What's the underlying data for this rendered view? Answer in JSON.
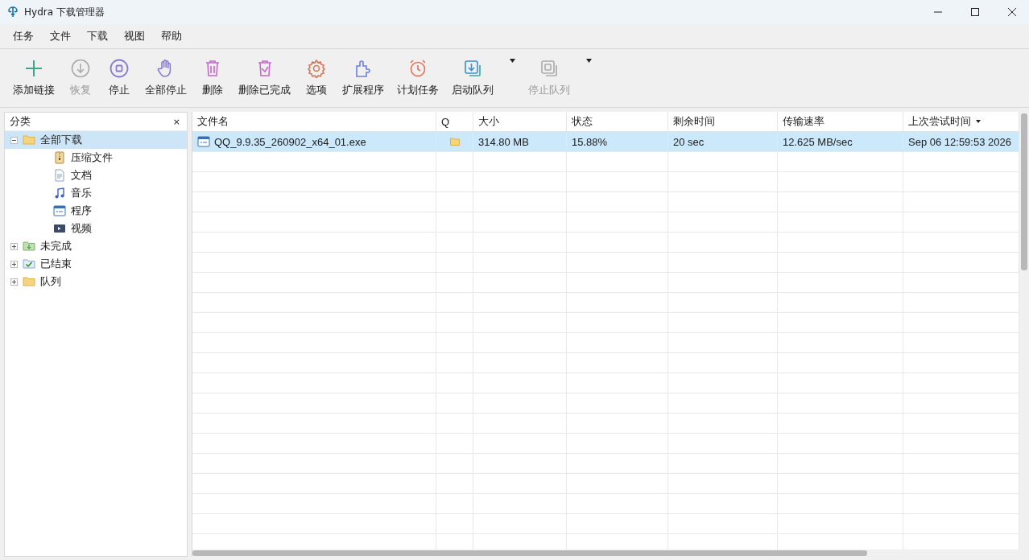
{
  "window": {
    "title": "Hydra 下载管理器"
  },
  "menu": [
    "任务",
    "文件",
    "下载",
    "视图",
    "帮助"
  ],
  "toolbar": [
    {
      "label": "添加链接",
      "disabled": false,
      "dropdown": false
    },
    {
      "label": "恢复",
      "disabled": true,
      "dropdown": false
    },
    {
      "label": "停止",
      "disabled": false,
      "dropdown": false
    },
    {
      "label": "全部停止",
      "disabled": false,
      "dropdown": false
    },
    {
      "label": "删除",
      "disabled": false,
      "dropdown": false
    },
    {
      "label": "删除已完成",
      "disabled": false,
      "dropdown": false
    },
    {
      "label": "选项",
      "disabled": false,
      "dropdown": false
    },
    {
      "label": "扩展程序",
      "disabled": false,
      "dropdown": false
    },
    {
      "label": "计划任务",
      "disabled": false,
      "dropdown": false
    },
    {
      "label": "启动队列",
      "disabled": false,
      "dropdown": true
    },
    {
      "label": "停止队列",
      "disabled": true,
      "dropdown": true
    }
  ],
  "sidebar": {
    "title": "分类",
    "close": "×",
    "items": [
      {
        "label": "全部下载",
        "selected": true,
        "expanded": true,
        "children": [
          {
            "label": "压缩文件",
            "selected": false
          },
          {
            "label": "文档",
            "selected": false
          },
          {
            "label": "音乐",
            "selected": false
          },
          {
            "label": "程序",
            "selected": false
          },
          {
            "label": "视频",
            "selected": false
          }
        ]
      },
      {
        "label": "未完成",
        "selected": false,
        "expanded": false
      },
      {
        "label": "已结束",
        "selected": false,
        "expanded": false
      },
      {
        "label": "队列",
        "selected": false,
        "expanded": false
      }
    ]
  },
  "table": {
    "columns": [
      {
        "label": "文件名",
        "sorted": false
      },
      {
        "label": "Q",
        "sorted": false
      },
      {
        "label": "大小",
        "sorted": false
      },
      {
        "label": "状态",
        "sorted": false
      },
      {
        "label": "剩余时间",
        "sorted": false
      },
      {
        "label": "传输速率",
        "sorted": false
      },
      {
        "label": "上次尝试时间",
        "sorted": true
      }
    ],
    "rows": [
      {
        "selected": true,
        "queued": true,
        "name": "QQ_9.9.35_260902_x64_01.exe",
        "size": "314.80 MB",
        "status": "15.88%",
        "remaining": "20 sec",
        "speed": "12.625 MB/sec",
        "last_try": "Sep 06 12:59:53 2026"
      }
    ]
  }
}
